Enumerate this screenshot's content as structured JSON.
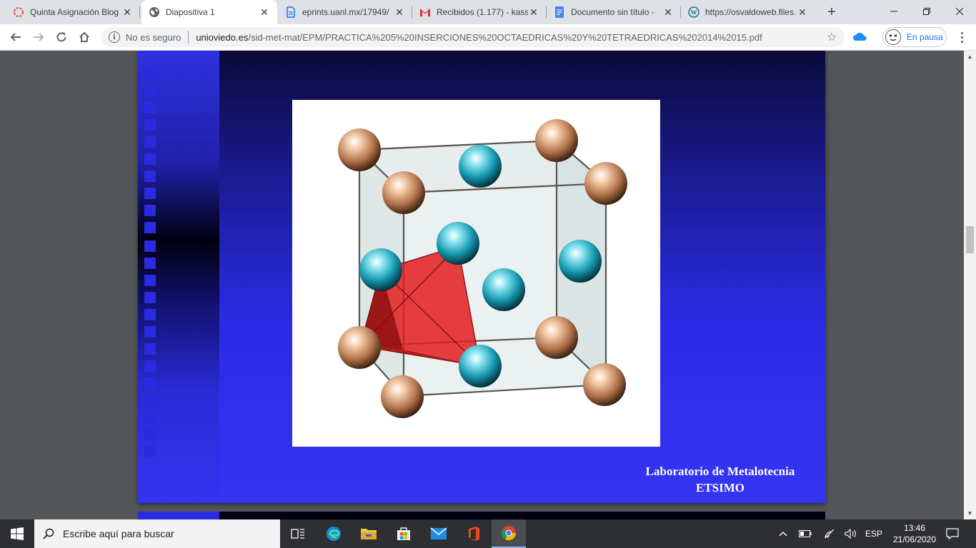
{
  "tabs": [
    {
      "title": "Quinta Asignación Blog",
      "icon": "blogger-loading-icon",
      "active": false
    },
    {
      "title": "Diapositiva 1",
      "icon": "globe-icon",
      "active": true
    },
    {
      "title": "eprints.uanl.mx/17949/",
      "icon": "document-icon",
      "active": false
    },
    {
      "title": "Recibidos (1.177) - kass",
      "icon": "gmail-icon",
      "active": false
    },
    {
      "title": "Documento sin título -",
      "icon": "google-docs-icon",
      "active": false
    },
    {
      "title": "https://osvaldoweb.files.",
      "icon": "wordpress-icon",
      "active": false
    }
  ],
  "toolbar": {
    "security_label": "No es seguro",
    "url_host": "unioviedo.es",
    "url_path": "/sid-met-mat/EPM/PRACTICA%205%20INSERCIONES%20OCTAEDRICAS%20Y%20TETRAEDRICAS%202014%2015.pdf",
    "profile_label": "En pausa"
  },
  "slide": {
    "footer_line1": "Laboratorio de Metalotecnia",
    "footer_line2": "ETSIMO"
  },
  "taskbar": {
    "search_placeholder": "Escribe aquí para buscar",
    "language": "ESP",
    "time": "13:46",
    "date": "21/06/2020"
  },
  "colors": {
    "slide_blue": "#3434f4",
    "corner_atom": "#e8b08a",
    "face_atom": "#1fb3c9",
    "tetrahedron": "#e01818"
  }
}
